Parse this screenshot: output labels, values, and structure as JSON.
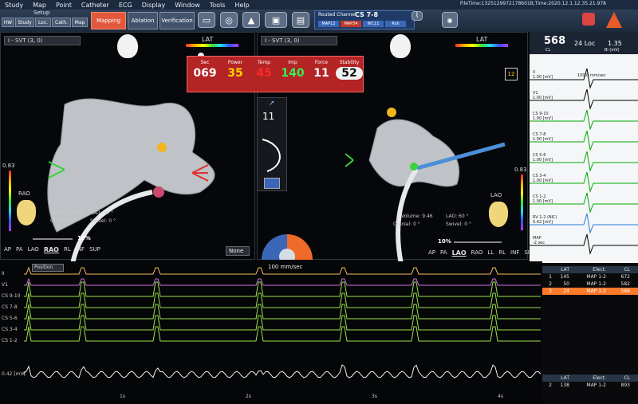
{
  "menu": [
    {
      "label": "Study",
      "u": "S"
    },
    {
      "label": "Map",
      "u": "M"
    },
    {
      "label": "Point",
      "u": "P"
    },
    {
      "label": "Catheter",
      "u": "C"
    },
    {
      "label": "ECG",
      "u": "E"
    },
    {
      "label": "Display",
      "u": "D"
    },
    {
      "label": "Window",
      "u": "W"
    },
    {
      "label": "Tools",
      "u": "T"
    },
    {
      "label": "Help",
      "u": "H"
    }
  ],
  "fileinfo": "FileTime:1325129972178601B,Time:2020.12.1.12.35.21.978",
  "toolbar": {
    "setup": "Setup",
    "small": [
      "HW",
      "Study",
      "Loc.",
      "Cath.",
      "Map"
    ],
    "mapping": "Mapping",
    "ablation": "Ablation",
    "verification": "Verification",
    "routed_label": "Routed Channel",
    "routed_channel": "CS 7-8",
    "routed_opts": [
      "MAP12",
      "MAP34",
      "WC11",
      "Rsh"
    ],
    "icon_num": "12"
  },
  "left_view": {
    "selector": "I - SVT (3, 0)",
    "lat": "LAT",
    "scale_top": "0.83",
    "projection": "RAO",
    "volume": "Volume: 9.46",
    "cranial": "Cranial: 0 °",
    "rao": "RAO: 30 °",
    "swivel": "Swivel: 0 °",
    "pct": "10%",
    "views": [
      "AP",
      "PA",
      "LAO",
      "RAO",
      "RL",
      "INF",
      "SUP"
    ],
    "active_view": "RAO",
    "dropdown": "None"
  },
  "right_view": {
    "selector": "I - SVT (3, 0)",
    "lat": "LAT",
    "scale_top": "0.83",
    "projection": "LAO",
    "volume": "Volume: 9.46",
    "cranial": "Cranial: 0 °",
    "lao": "LAO: 60 °",
    "swivel": "Swivel: 0 °",
    "pct": "10%",
    "views": [
      "AP",
      "PA",
      "LAO",
      "RAO",
      "LL",
      "RL",
      "INF",
      "SUP"
    ],
    "active_view": "LAO",
    "badge": "12"
  },
  "ablation": {
    "items": [
      {
        "title": "Sec",
        "value": "069",
        "color": "#ffffff"
      },
      {
        "title": "Power",
        "value": "35",
        "color": "#ffd200"
      },
      {
        "title": "Temp",
        "value": "45",
        "color": "#ff2a2a"
      },
      {
        "title": "Imp",
        "value": "140",
        "color": "#36f05a"
      },
      {
        "title": "Force",
        "value": "11",
        "color": "#ffffff"
      },
      {
        "title": "Stability",
        "value": "52",
        "color": "#111111"
      }
    ]
  },
  "force_panel": {
    "value": "11"
  },
  "right_panel": {
    "cl": "568",
    "loc": "24 Loc",
    "bi": "1.35",
    "units": "Bi (mV)",
    "speed": "100.0 mm/sec",
    "lat_label": "CL",
    "leads": [
      "II",
      "V1",
      "CS 9-10",
      "CS 7-8",
      "CS 5-6",
      "CS 3-4",
      "CS 1-2",
      "RV 1-2 (NIC)",
      "MAP"
    ],
    "gains": [
      "1.00 [mV]",
      "1.00 [mV]",
      "1.00 [mV]",
      "1.00 [mV]",
      "1.00 [mV]",
      "1.00 [mV]",
      "1.00 [mV]",
      "0.42 [mV]",
      ""
    ],
    "bottom": "-2 sec"
  },
  "egm": {
    "speed": "100 mm/sec",
    "selector": "Position",
    "labels": [
      "II",
      "V1",
      "CS 9-10",
      "CS 7-8",
      "CS 5-6",
      "CS 3-4",
      "CS 1-2",
      "0.42 [mV]"
    ],
    "ticks": [
      "1s",
      "2s",
      "3s",
      "4s"
    ]
  },
  "lat_table": {
    "headers": [
      "",
      "LAT",
      "Elect.",
      "CL"
    ],
    "rows": [
      [
        "1",
        "145",
        "MAP 1-2",
        "672"
      ],
      [
        "2",
        "50",
        "MAP 1-2",
        "582"
      ],
      [
        "3",
        "24",
        "MAP 1-2",
        "568"
      ]
    ],
    "selected": 2
  },
  "lat_table2": {
    "headers": [
      "",
      "LAT",
      "Elect.",
      "CL"
    ],
    "rows": [
      [
        "2",
        "138",
        "MAP 1-2",
        "893"
      ]
    ]
  }
}
